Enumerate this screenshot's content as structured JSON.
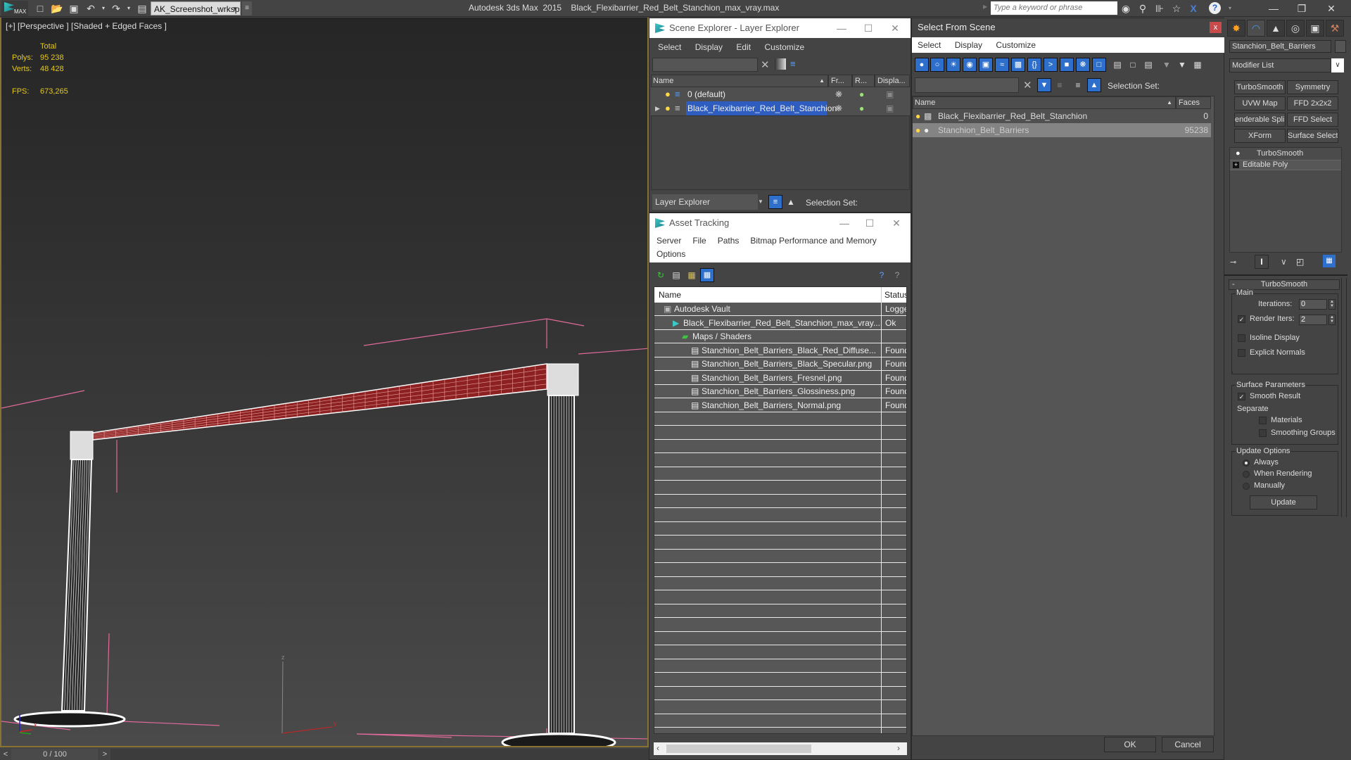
{
  "titlebar": {
    "logo_text": "MAX",
    "workspace": "AK_Screenshot_wrksp",
    "app_title": "Autodesk 3ds Max  2015    Black_Flexibarrier_Red_Belt_Stanchion_max_vray.max",
    "search_placeholder": "Type a keyword or phrase",
    "icons": [
      "new-file-icon",
      "open-file-icon",
      "save-icon",
      "undo-icon",
      "redo-icon",
      "project-folder-icon"
    ],
    "right_icons": [
      "binoculars-icon",
      "key-icon",
      "satellite-icon",
      "star-icon",
      "x-exchange-icon",
      "help-icon"
    ]
  },
  "viewport": {
    "label": "[+] [Perspective ] [Shaded + Edged Faces ]",
    "stats": {
      "total_label": "Total",
      "polys_label": "Polys:",
      "polys_value": "95 238",
      "verts_label": "Verts:",
      "verts_value": "48 428",
      "fps_label": "FPS:",
      "fps_value": "673,265"
    },
    "axis_labels": {
      "x": "x",
      "y": "y",
      "z": "z"
    }
  },
  "timeslider": {
    "prev": "<",
    "position": "0 / 100",
    "next": ">",
    "current_frame": 0,
    "total_frames": 100
  },
  "scene_explorer": {
    "title": "Scene Explorer - Layer Explorer",
    "menu": [
      "Select",
      "Display",
      "Edit",
      "Customize"
    ],
    "columns": [
      "Name",
      "Fr...",
      "R...",
      "Displa..."
    ],
    "rows": [
      {
        "name": "0 (default)",
        "selected": false
      },
      {
        "name": "Black_Flexibarrier_Red_Belt_Stanchion",
        "selected": true
      }
    ],
    "footer_dropdown": "Layer Explorer",
    "selection_set_label": "Selection Set:"
  },
  "asset_tracking": {
    "title": "Asset Tracking",
    "menu": [
      "Server",
      "File",
      "Paths",
      "Bitmap Performance and Memory",
      "Options"
    ],
    "columns": [
      "Name",
      "Status"
    ],
    "rows": [
      {
        "name": "Autodesk Vault",
        "status": "Logged",
        "indent": 1,
        "icon": "vault-icon"
      },
      {
        "name": "Black_Flexibarrier_Red_Belt_Stanchion_max_vray...",
        "status": "Ok",
        "indent": 2,
        "icon": "max-file-icon"
      },
      {
        "name": "Maps / Shaders",
        "status": "",
        "indent": 3,
        "icon": "maps-icon"
      },
      {
        "name": "Stanchion_Belt_Barriers_Black_Red_Diffuse...",
        "status": "Found",
        "indent": 4,
        "icon": "bitmap-icon"
      },
      {
        "name": "Stanchion_Belt_Barriers_Black_Specular.png",
        "status": "Found",
        "indent": 4,
        "icon": "bitmap-icon"
      },
      {
        "name": "Stanchion_Belt_Barriers_Fresnel.png",
        "status": "Found",
        "indent": 4,
        "icon": "bitmap-icon"
      },
      {
        "name": "Stanchion_Belt_Barriers_Glossiness.png",
        "status": "Found",
        "indent": 4,
        "icon": "bitmap-icon"
      },
      {
        "name": "Stanchion_Belt_Barriers_Normal.png",
        "status": "Found",
        "indent": 4,
        "icon": "bitmap-icon"
      }
    ]
  },
  "select_from_scene": {
    "title": "Select From Scene",
    "close": "x",
    "menu": [
      "Select",
      "Display",
      "Customize"
    ],
    "selection_set_label": "Selection Set:",
    "columns": [
      "Name",
      "Faces"
    ],
    "rows": [
      {
        "name": "Black_Flexibarrier_Red_Belt_Stanchion",
        "faces": "0",
        "selected": false
      },
      {
        "name": "Stanchion_Belt_Barriers",
        "faces": "95238",
        "selected": true
      }
    ],
    "ok": "OK",
    "cancel": "Cancel"
  },
  "command_panel": {
    "object_name": "Stanchion_Belt_Barriers",
    "object_color": "#555555",
    "modifier_list": "Modifier List",
    "modifier_buttons": [
      "TurboSmooth",
      "Symmetry",
      "UVW Map",
      "FFD 2x2x2",
      "enderable Splin",
      "FFD Select",
      "XForm",
      "Surface Select"
    ],
    "stack": [
      "TurboSmooth",
      "Editable Poly"
    ],
    "rollout_title": "TurboSmooth",
    "main_group": "Main",
    "iterations_label": "Iterations:",
    "iterations_value": "0",
    "render_iters_label": "Render Iters:",
    "render_iters_value": "2",
    "render_iters_checked": true,
    "isoline_label": "Isoline Display",
    "isoline_checked": false,
    "explicit_normals_label": "Explicit Normals",
    "explicit_normals_checked": false,
    "surface_group": "Surface Parameters",
    "smooth_result_label": "Smooth Result",
    "smooth_result_checked": true,
    "separate_label": "Separate",
    "materials_label": "Materials",
    "smoothing_groups_label": "Smoothing Groups",
    "update_group": "Update Options",
    "update_options": [
      "Always",
      "When Rendering",
      "Manually"
    ],
    "update_selected": "Always",
    "update_button": "Update"
  }
}
